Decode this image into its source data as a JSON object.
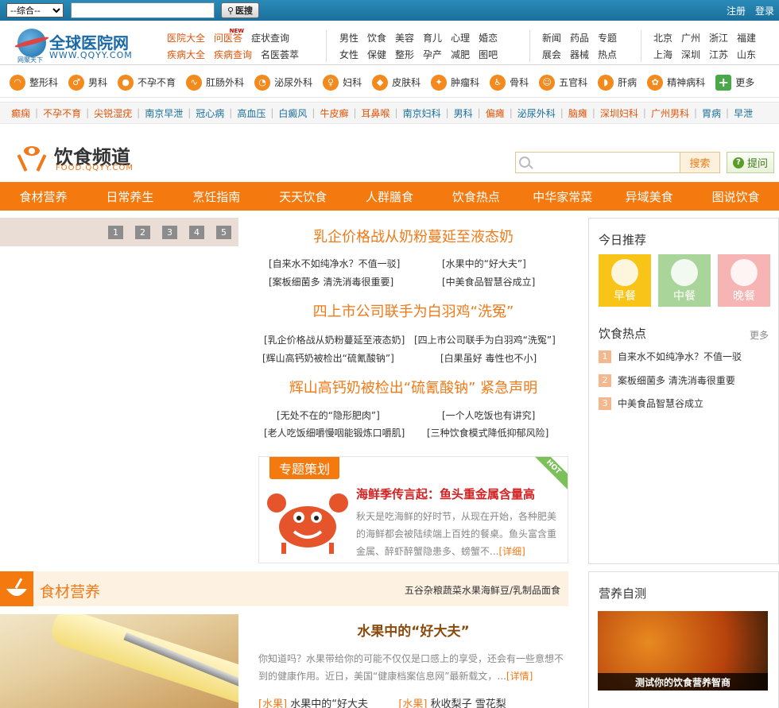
{
  "topbar": {
    "select_value": "--综合--",
    "search_button": "医搜",
    "register": "注册",
    "login": "登录"
  },
  "logo": {
    "name": "全球医院网",
    "url": "WWW.QQYY.COM",
    "tag": "网聚天下"
  },
  "header": {
    "col1": [
      "医院大全",
      "问医答",
      "症状查询",
      "疾病大全",
      "疾病查询",
      "名医荟萃"
    ],
    "col2": [
      "男性",
      "饮食",
      "美容",
      "育儿",
      "心理",
      "婚恋",
      "女性",
      "保健",
      "整形",
      "孕产",
      "减肥",
      "图吧"
    ],
    "col3": [
      "新闻",
      "药品",
      "专题",
      "展会",
      "器械",
      "热点"
    ],
    "col4": [
      "北京",
      "广州",
      "浙江",
      "福建",
      "上海",
      "深圳",
      "江苏",
      "山东"
    ],
    "new_badge": "NEW"
  },
  "departments": [
    "整形科",
    "男科",
    "不孕不育",
    "肛肠外科",
    "泌尿外科",
    "妇科",
    "皮肤科",
    "肿瘤科",
    "骨科",
    "五官科",
    "肝病",
    "精神病科",
    "更多"
  ],
  "disease_links": [
    "癫痫",
    "不孕不育",
    "尖锐湿疣",
    "南京早泄",
    "冠心病",
    "高血压",
    "白癜风",
    "牛皮癣",
    "耳鼻喉",
    "南京妇科",
    "男科",
    "偏瘫",
    "泌尿外科",
    "脑瘫",
    "深圳妇科",
    "广州男科",
    "胃病",
    "早泄"
  ],
  "channel": {
    "name": "饮食频道",
    "url": "FOOD.QQYY.COM",
    "search_button": "搜索",
    "ask_button": "提问"
  },
  "nav": [
    "食材营养",
    "日常养生",
    "烹饪指南",
    "天天饮食",
    "人群膳食",
    "饮食热点",
    "中华家常菜",
    "异域美食",
    "图说饮食"
  ],
  "slider_pages": [
    "1",
    "2",
    "3",
    "4",
    "5"
  ],
  "headlines": [
    {
      "title": "乳企价格战从奶粉蔓延至液态奶",
      "links": [
        "[自来水不如纯净水？不值一驳]",
        "[水果中的“好大夫”]",
        "[案板细菌多 清洗消毒很重要]",
        "[中美食品智慧谷成立]"
      ]
    },
    {
      "title": "四上市公司联手为白羽鸡“洗冤”",
      "links": [
        "[乳企价格战从奶粉蔓延至液态奶]",
        "[四上市公司联手为白羽鸡“洗冤”]",
        "[辉山高钙奶被检出“硫氰酸钠”]",
        "[白果虽好 毒性也不小]"
      ]
    },
    {
      "title": "辉山高钙奶被检出“硫氰酸钠” 紧急声明",
      "links": [
        "[无处不在的“隐形肥肉”]",
        "[一个人吃饭也有讲究]",
        "[老人吃饭细嚼慢咽能锻炼口嚼肌]",
        "[三种饮食模式降低抑郁风险]"
      ]
    }
  ],
  "feature": {
    "tag": "专题策划",
    "hot": "HOT",
    "title": "海鲜季传言起：鱼头重金属含量高",
    "body": "秋天是吃海鲜的好时节，从现在开始，各种肥美的海鲜都会被陆续端上百姓的餐桌。鱼头富含重金属、醉虾醉蟹隐患多、螃蟹不...",
    "more": "[详细]"
  },
  "sidebar": {
    "today_title": "今日推荐",
    "meals": [
      "早餐",
      "中餐",
      "晚餐"
    ],
    "hot_title": "饮食热点",
    "hot_more": "更多",
    "hot_items": [
      {
        "num": "1",
        "text": "自来水不如纯净水？不值一驳"
      },
      {
        "num": "2",
        "text": "案板细菌多 清洗消毒很重要"
      },
      {
        "num": "3",
        "text": "中美食品智慧谷成立"
      }
    ],
    "test_title": "营养自测",
    "test_caption": "测试你的饮食营养智商"
  },
  "section": {
    "title": "食材营养",
    "tabs": [
      "五谷杂粮",
      "蔬菜",
      "水果",
      "海鲜",
      "豆/乳制品",
      "面食"
    ],
    "article_title": "水果中的“好大夫”",
    "article_body": "你知道吗？水果带给你的可能不仅仅是口感上的享受，还会有一些意想不到的健康作用。近日，美国“健康档案信息网”最新载文，...",
    "article_more": "[详情]",
    "links": [
      {
        "tag": "[水果]",
        "text": "水果中的“好大夫"
      },
      {
        "tag": "[水果]",
        "text": "秋收梨子 雪花梨"
      }
    ]
  },
  "colors": {
    "brand_orange": "#f47a10",
    "topbar_blue": "#1b6f9c",
    "headline_orange": "#f07a18"
  }
}
